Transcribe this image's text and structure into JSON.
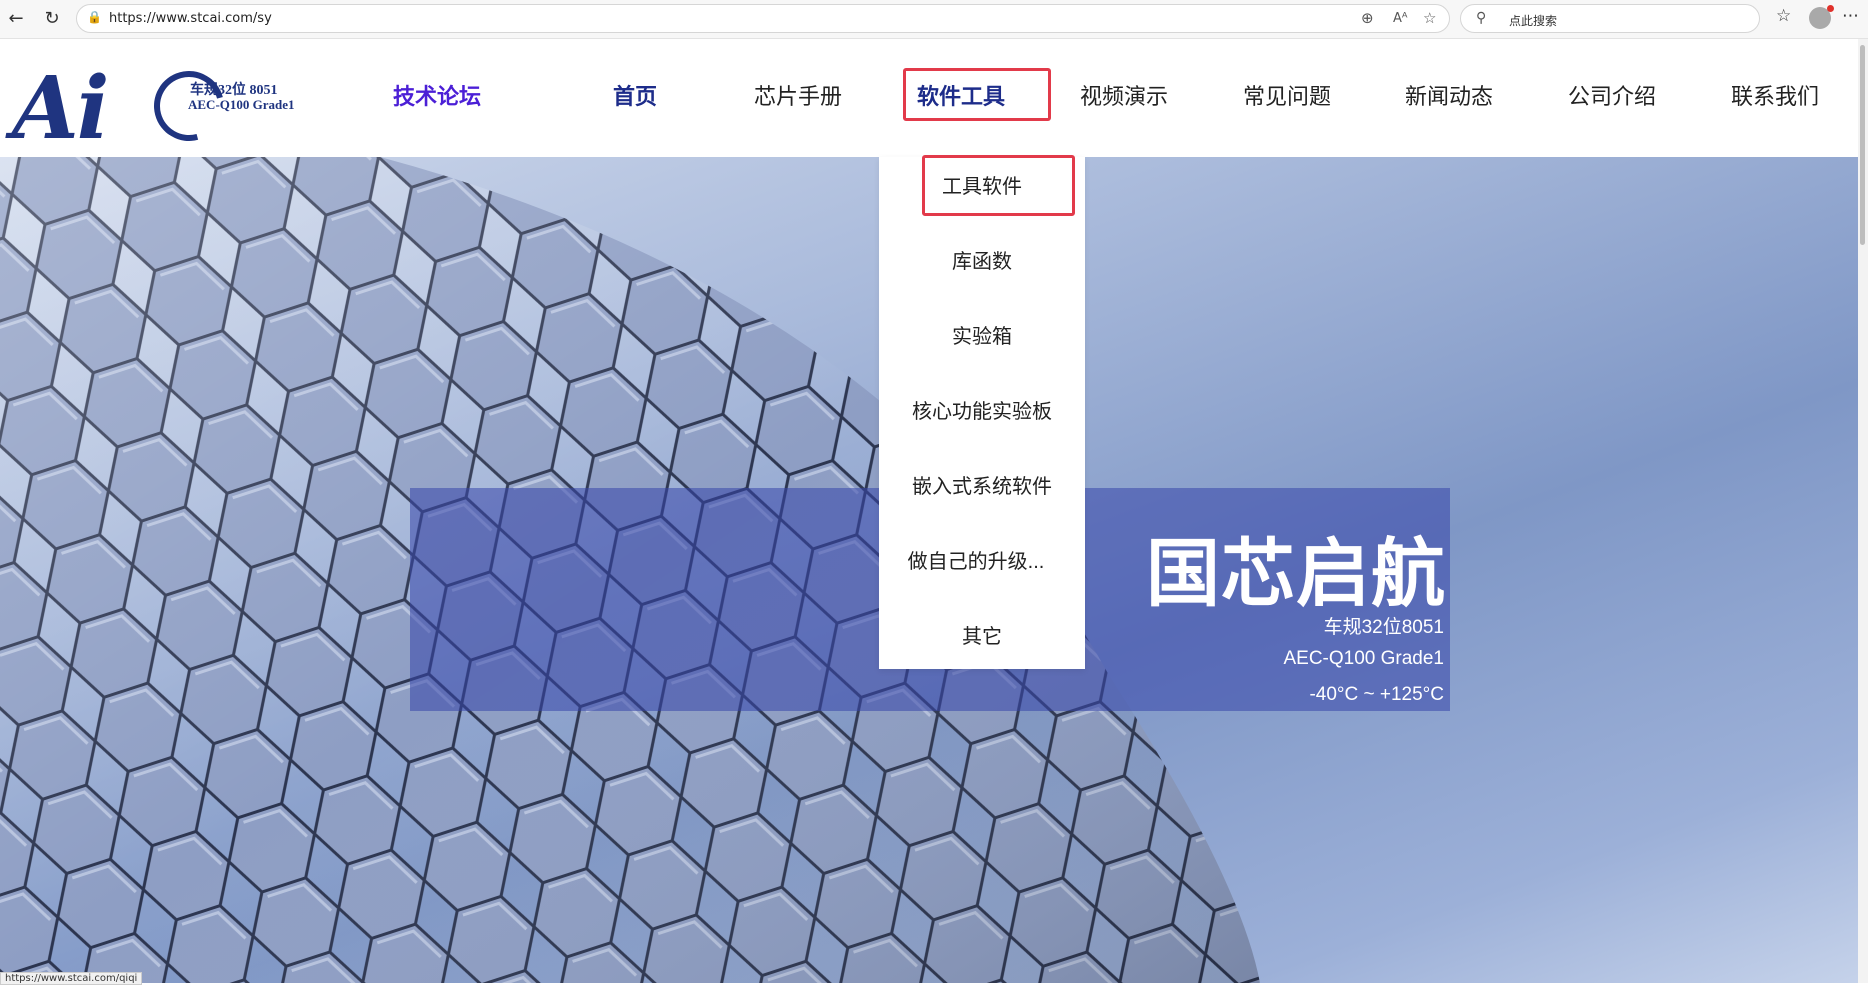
{
  "browser": {
    "url": "https://www.stcai.com/sy",
    "search_placeholder": "点此搜索",
    "status_url": "https://www.stcai.com/qiqi"
  },
  "logo": {
    "mark": "Ai",
    "line1": "车规32位 8051",
    "line2": "AEC-Q100 Grade1"
  },
  "nav": {
    "forum": "技术论坛",
    "home": "首页",
    "chip_manual": "芯片手册",
    "software_tools": "软件工具",
    "video_demo": "视频演示",
    "faq": "常见问题",
    "news": "新闻动态",
    "about": "公司介绍",
    "contact": "联系我们"
  },
  "dropdown": {
    "items": [
      "工具软件",
      "库函数",
      "实验箱",
      "核心功能实验板",
      "嵌入式系统软件",
      "做自己的升级...",
      "其它"
    ]
  },
  "hero": {
    "title": "国芯启航",
    "line1": "车规32位8051",
    "line2": "AEC-Q100 Grade1",
    "line3": "-40°C ~ +125°C"
  },
  "colors": {
    "highlight": "#e23a4a",
    "nav_forum": "#4b1fd6",
    "nav_home": "#1d2c8a",
    "logo": "#1f3480"
  }
}
